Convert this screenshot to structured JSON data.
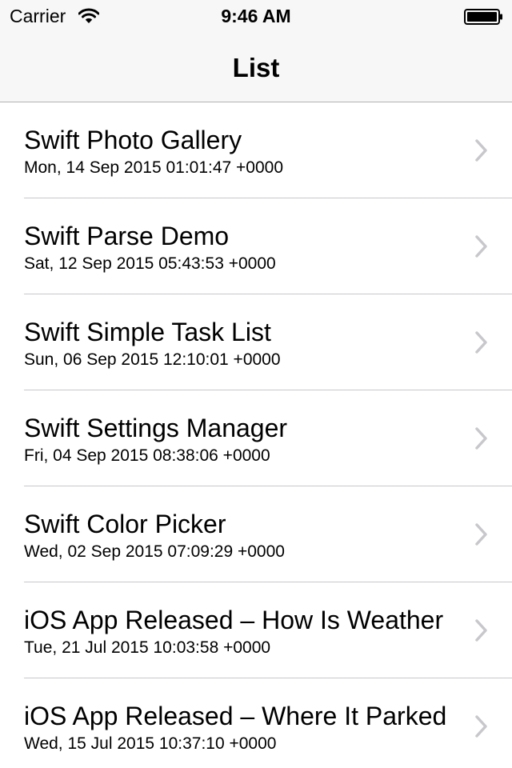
{
  "status_bar": {
    "carrier": "Carrier",
    "time": "9:46 AM",
    "wifi_icon": "wifi-icon",
    "battery_icon": "battery-icon"
  },
  "nav": {
    "title": "List"
  },
  "colors": {
    "chrome_background": "#f7f7f7",
    "separator": "#c8c7cc",
    "chevron": "#c7c7cc"
  },
  "list": {
    "items": [
      {
        "title": "Swift Photo Gallery",
        "date": "Mon, 14 Sep 2015 01:01:47 +0000",
        "icon": "chevron-right-icon"
      },
      {
        "title": "Swift Parse Demo",
        "date": "Sat, 12 Sep 2015 05:43:53 +0000",
        "icon": "chevron-right-icon"
      },
      {
        "title": "Swift Simple Task List",
        "date": "Sun, 06 Sep 2015 12:10:01 +0000",
        "icon": "chevron-right-icon"
      },
      {
        "title": "Swift Settings Manager",
        "date": "Fri, 04 Sep 2015 08:38:06 +0000",
        "icon": "chevron-right-icon"
      },
      {
        "title": "Swift Color Picker",
        "date": "Wed, 02 Sep 2015 07:09:29 +0000",
        "icon": "chevron-right-icon"
      },
      {
        "title": "iOS App Released – How Is Weather",
        "date": "Tue, 21 Jul 2015 10:03:58 +0000",
        "icon": "chevron-right-icon"
      },
      {
        "title": "iOS App Released – Where It Parked",
        "date": "Wed, 15 Jul 2015 10:37:10 +0000",
        "icon": "chevron-right-icon"
      }
    ]
  }
}
